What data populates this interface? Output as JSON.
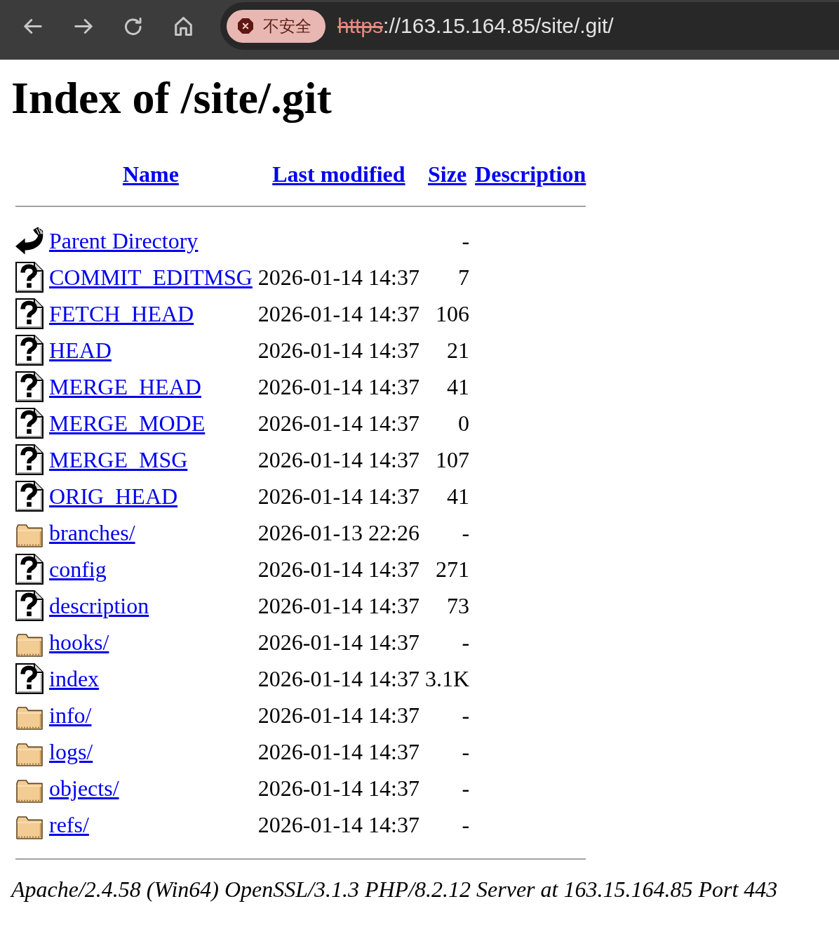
{
  "browser": {
    "security": {
      "label": "不安全",
      "insecure": true
    },
    "url": {
      "scheme": "https",
      "rest": "://163.15.164.85/site/.git/"
    }
  },
  "page": {
    "title": "Index of /site/.git",
    "columns": [
      "Name",
      "Last modified",
      "Size",
      "Description"
    ],
    "rows": [
      {
        "kind": "parent",
        "name": "Parent Directory",
        "size": "-"
      },
      {
        "kind": "file",
        "name": "COMMIT_EDITMSG",
        "modified": "2026-01-14 14:37",
        "size": "7"
      },
      {
        "kind": "file",
        "name": "FETCH_HEAD",
        "modified": "2026-01-14 14:37",
        "size": "106"
      },
      {
        "kind": "file",
        "name": "HEAD",
        "modified": "2026-01-14 14:37",
        "size": "21"
      },
      {
        "kind": "file",
        "name": "MERGE_HEAD",
        "modified": "2026-01-14 14:37",
        "size": "41"
      },
      {
        "kind": "file",
        "name": "MERGE_MODE",
        "modified": "2026-01-14 14:37",
        "size": "0"
      },
      {
        "kind": "file",
        "name": "MERGE_MSG",
        "modified": "2026-01-14 14:37",
        "size": "107"
      },
      {
        "kind": "file",
        "name": "ORIG_HEAD",
        "modified": "2026-01-14 14:37",
        "size": "41"
      },
      {
        "kind": "folder",
        "name": "branches/",
        "modified": "2026-01-13 22:26",
        "size": "-"
      },
      {
        "kind": "file",
        "name": "config",
        "modified": "2026-01-14 14:37",
        "size": "271"
      },
      {
        "kind": "file",
        "name": "description",
        "modified": "2026-01-14 14:37",
        "size": "73"
      },
      {
        "kind": "folder",
        "name": "hooks/",
        "modified": "2026-01-14 14:37",
        "size": "-"
      },
      {
        "kind": "file",
        "name": "index",
        "modified": "2026-01-14 14:37",
        "size": "3.1K"
      },
      {
        "kind": "folder",
        "name": "info/",
        "modified": "2026-01-14 14:37",
        "size": "-"
      },
      {
        "kind": "folder",
        "name": "logs/",
        "modified": "2026-01-14 14:37",
        "size": "-"
      },
      {
        "kind": "folder",
        "name": "objects/",
        "modified": "2026-01-14 14:37",
        "size": "-"
      },
      {
        "kind": "folder",
        "name": "refs/",
        "modified": "2026-01-14 14:37",
        "size": "-"
      }
    ],
    "footer": "Apache/2.4.58 (Win64) OpenSSL/3.1.3 PHP/8.2.12 Server at 163.15.164.85 Port 443"
  }
}
